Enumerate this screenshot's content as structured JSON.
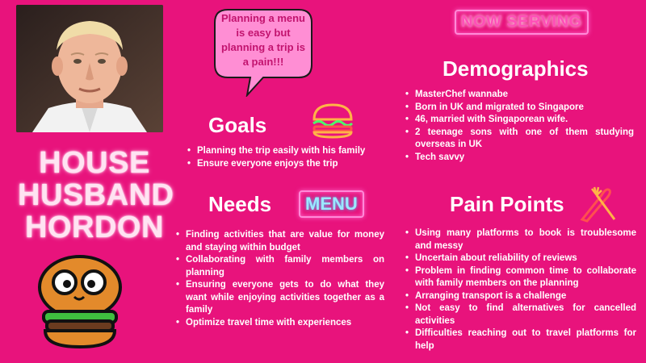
{
  "speech_bubble": "Planning a menu is easy but planning a trip is a pain!!!",
  "persona_name": [
    "HOUSE",
    "HUSBAND",
    "HORDON"
  ],
  "now_serving_sign": "NOW SERVING",
  "menu_sign": "MENU",
  "demographics": {
    "title": "Demographics",
    "items": [
      "MasterChef wannabe",
      "Born in UK and migrated to Singapore",
      "46, married with Singaporean wife.",
      "2 teenage sons with one of them studying overseas in UK",
      "Tech savvy"
    ]
  },
  "goals": {
    "title": "Goals",
    "items": [
      "Planning the trip easily with his family",
      "Ensure everyone enjoys the trip"
    ]
  },
  "needs": {
    "title": "Needs",
    "items": [
      "Finding activities that are value for money and staying within budget",
      "Collaborating with family members on planning",
      "Ensuring everyone gets to do what they want while enjoying activities together as a family",
      "Optimize travel time with experiences"
    ]
  },
  "pain_points": {
    "title": "Pain Points",
    "items": [
      "Using many platforms to book is troublesome and messy",
      "Uncertain about reliability of reviews",
      "Problem in finding common time to collaborate with family members on the planning",
      "Arranging transport is a challenge",
      "Not easy to find alternatives for cancelled activities",
      "Difficulties reaching out to travel platforms for help"
    ]
  },
  "colors": {
    "background": "#e8137c",
    "bubble": "#ff8ed4",
    "text": "#ffffff"
  },
  "icons": [
    "portrait-photo",
    "burger-icon",
    "fork-knife-icon",
    "burger-mascot-icon"
  ]
}
